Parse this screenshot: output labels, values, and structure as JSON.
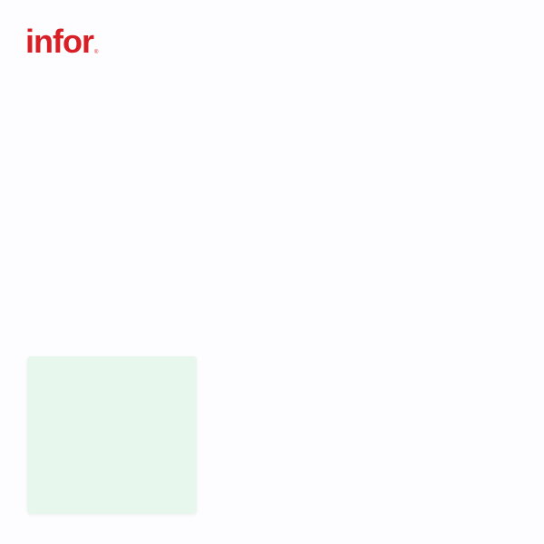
{
  "brand": {
    "name": "infor",
    "registered_mark": "®",
    "color": "#d81f26"
  },
  "card": {
    "background": "#e7f7ee"
  },
  "page": {
    "background": "#fdfcfe"
  }
}
